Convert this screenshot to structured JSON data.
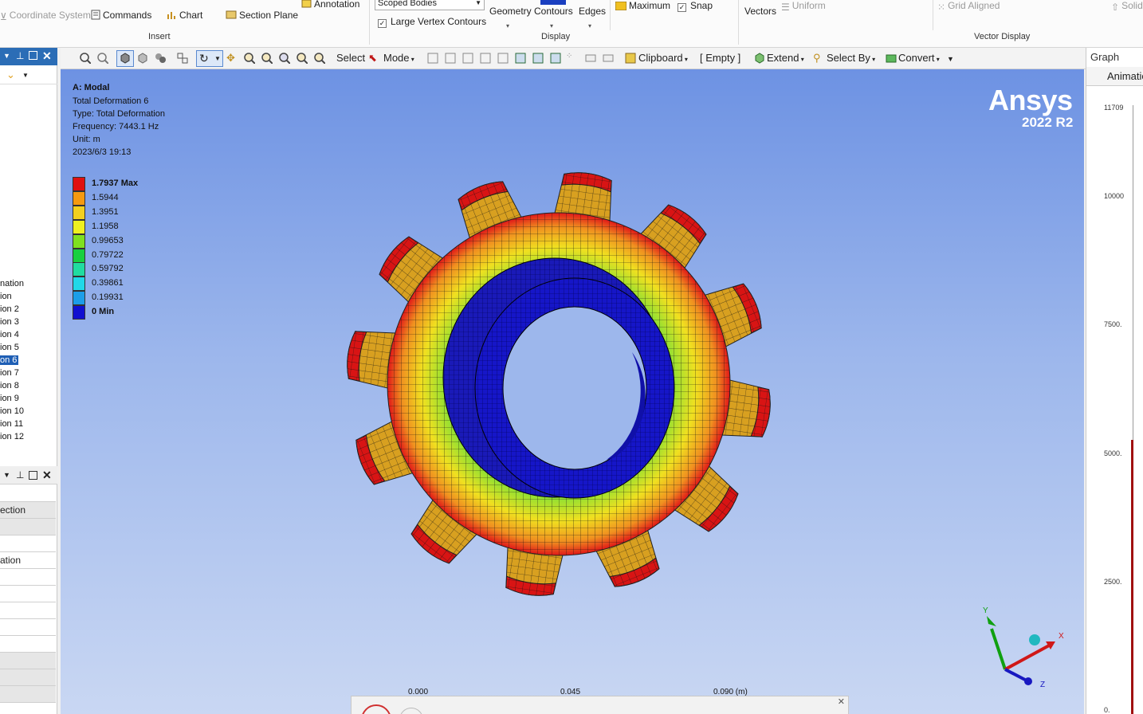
{
  "ribbon": {
    "coordinate_system": "Coordinate System",
    "commands": "Commands",
    "chart": "Chart",
    "section_plane": "Section Plane",
    "annotation": "Annotation",
    "insert_group": "Insert",
    "scope_select": "Scoped Bodies",
    "large_vertex_contours": "Large Vertex Contours",
    "geometry": "Geometry",
    "contours": "Contours",
    "edges": "Edges",
    "display_group": "Display",
    "maximum": "Maximum",
    "snap": "Snap",
    "vectors": "Vectors",
    "uniform": "Uniform",
    "grid_aligned": "Grid Aligned",
    "solid": "Solid",
    "vector_display_group": "Vector Display"
  },
  "toolbar": {
    "select": "Select",
    "mode": "Mode",
    "clipboard": "Clipboard",
    "empty": "[ Empty ]",
    "extend": "Extend",
    "select_by": "Select By",
    "convert": "Convert"
  },
  "tree": {
    "items": [
      "nation",
      "ion",
      "ion 2",
      "ion 3",
      "ion 4",
      "ion 5",
      "on 6",
      "ion 7",
      "ion 8",
      "ion 9",
      "ion 10",
      "ion 11",
      "ion 12"
    ],
    "selected_index": 6
  },
  "details": {
    "rows": [
      "",
      "ection",
      "",
      "",
      "ation",
      "",
      "",
      "",
      "",
      "",
      "",
      "",
      ""
    ]
  },
  "viewport": {
    "result_title": "A: Modal",
    "result_name": "Total Deformation 6",
    "type_line": "Type: Total Deformation",
    "frequency_line": "Frequency: 7443.1 Hz",
    "unit_line": "Unit: m",
    "date_line": "2023/6/3 19:13",
    "brand": "Ansys",
    "version": "2022 R2",
    "legend": [
      {
        "label": "1.7937 Max",
        "color": "#e01010"
      },
      {
        "label": "1.5944",
        "color": "#f59a10"
      },
      {
        "label": "1.3951",
        "color": "#f2d020"
      },
      {
        "label": "1.1958",
        "color": "#eef020"
      },
      {
        "label": "0.99653",
        "color": "#7fe020"
      },
      {
        "label": "0.79722",
        "color": "#18d040"
      },
      {
        "label": "0.59792",
        "color": "#20dca0"
      },
      {
        "label": "0.39861",
        "color": "#20d8e8"
      },
      {
        "label": "0.19931",
        "color": "#1c9ee8"
      },
      {
        "label": "0 Min",
        "color": "#1010d0"
      }
    ],
    "scale": [
      "0.000",
      "0.045",
      "0.090 (m)"
    ],
    "axes": {
      "x": "X",
      "y": "Y",
      "z": "Z"
    }
  },
  "graph": {
    "title": "Graph",
    "tab": "Animation",
    "ticks": [
      "11709",
      "10000",
      "7500.",
      "5000.",
      "2500.",
      "0."
    ]
  }
}
